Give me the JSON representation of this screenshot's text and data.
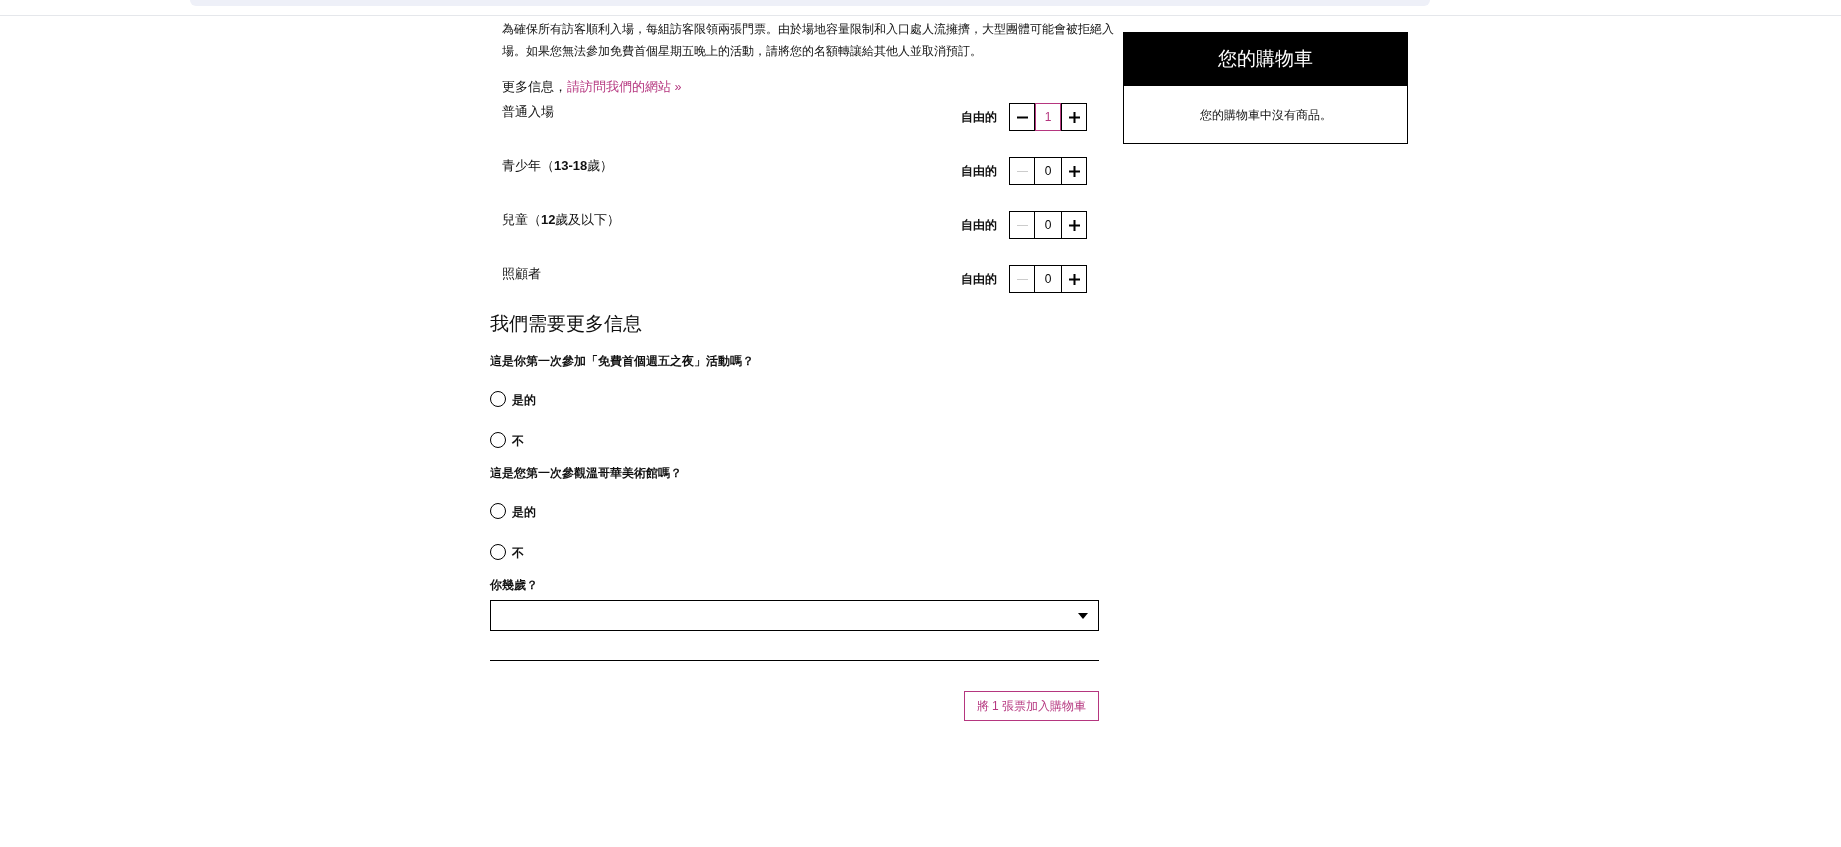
{
  "intro": "為確保所有訪客順利入場，每組訪客限領兩張門票。由於場地容量限制和入口處人流擁擠，大型團體可能會被拒絕入場。如果您無法參加免費首個星期五晚上的活動，請將您的名額轉讓給其他人並取消預訂。",
  "more_info": {
    "text": "更多信息，",
    "link": "請訪問我們的網站 »"
  },
  "tickets": [
    {
      "label": "普通入場",
      "availability": "自由的",
      "quantity": "1",
      "active": true,
      "decrement_disabled": false
    },
    {
      "label": "青少年（**13-18**歲）",
      "availability": "自由的",
      "quantity": "0",
      "active": false,
      "decrement_disabled": true
    },
    {
      "label": "兒童（**12**歲及以下）",
      "availability": "自由的",
      "quantity": "0",
      "active": false,
      "decrement_disabled": true
    },
    {
      "label": "照顧者",
      "availability": "自由的",
      "quantity": "0",
      "active": false,
      "decrement_disabled": true
    }
  ],
  "form": {
    "heading": "我們需要更多信息",
    "questions": [
      {
        "label": "這是你第一次參加「免費首個週五之夜」活動嗎？",
        "options": [
          {
            "label": "是的",
            "selected": false
          },
          {
            "label": "不",
            "selected": false
          }
        ]
      },
      {
        "label": "這是您第一次參觀溫哥華美術館嗎？",
        "options": [
          {
            "label": "是的",
            "selected": false
          },
          {
            "label": "不",
            "selected": false
          }
        ]
      }
    ],
    "age": {
      "label": "你幾歲？"
    }
  },
  "submit_button": "將 1 張票加入購物車",
  "cart": {
    "title": "您的購物車",
    "empty_message": "您的購物車中沒有商品。"
  }
}
